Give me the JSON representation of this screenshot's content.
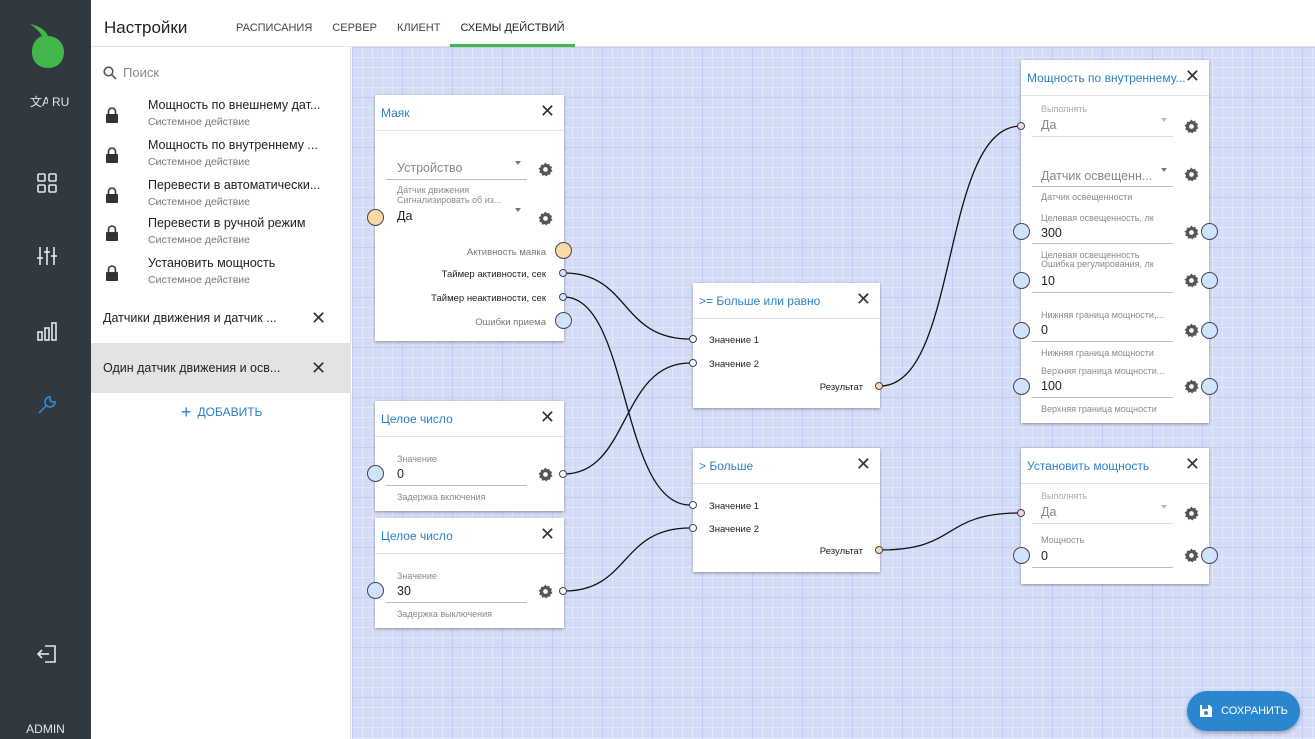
{
  "rail": {
    "language": "RU",
    "user": "ADMIN"
  },
  "header": {
    "title": "Настройки",
    "tabs": [
      {
        "label": "РАСПИСАНИЯ",
        "active": false
      },
      {
        "label": "СЕРВЕР",
        "active": false
      },
      {
        "label": "КЛИЕНТ",
        "active": false
      },
      {
        "label": "СХЕМЫ ДЕЙСТВИЙ",
        "active": true
      }
    ]
  },
  "panel": {
    "search_placeholder": "Поиск",
    "system_actions": [
      {
        "name": "Мощность по внешнему дат...",
        "sub": "Системное действие"
      },
      {
        "name": "Мощность по внутреннему ...",
        "sub": "Системное действие"
      },
      {
        "name": "Перевести в автоматически...",
        "sub": "Системное действие"
      },
      {
        "name": "Перевести в ручной режим",
        "sub": "Системное действие"
      },
      {
        "name": "Установить мощность",
        "sub": "Системное действие"
      }
    ],
    "schemes": [
      {
        "name": "Датчики движения и датчик ...",
        "selected": false
      },
      {
        "name": "Один датчик движения и осв...",
        "selected": true
      }
    ],
    "add_label": "ДОБАВИТЬ"
  },
  "nodes": {
    "beacon": {
      "title": "Маяк",
      "device_placeholder": "Устройство",
      "device_hint": "Датчик движения",
      "signal_label": "Сигнализировать об из...",
      "signal_value": "Да",
      "outputs": [
        "Активность маяка",
        "Таймер активности, сек",
        "Таймер неактивности, сек",
        "Ошибки приема"
      ]
    },
    "int1": {
      "title": "Целое число",
      "label": "Значение",
      "value": "0",
      "caption": "Задержка включения"
    },
    "int2": {
      "title": "Целое число",
      "label": "Значение",
      "value": "30",
      "caption": "Задержка выключения"
    },
    "gte": {
      "title": ">= Больше или равно",
      "in1": "Значение 1",
      "in2": "Значение 2",
      "out": "Результат"
    },
    "gt": {
      "title": "> Больше",
      "in1": "Значение 1",
      "in2": "Значение 2",
      "out": "Результат"
    },
    "power_internal": {
      "title": "Мощность по внутреннему...",
      "exec_label": "Выполнять",
      "exec_value": "Да",
      "sensor_value": "Датчик освещенн...",
      "sensor_caption": "Датчик освещенности",
      "target_label": "Целевая освещенность, лк",
      "target_value": "300",
      "target_caption": "Целевая освещенность",
      "error_label": "Ошибка регулирования, лк",
      "error_value": "10",
      "low_label": "Нижняя граница мощности,...",
      "low_value": "0",
      "low_caption": "Нижняя граница мощности",
      "high_label": "Верхняя граница мощности...",
      "high_value": "100",
      "high_caption": "Верхняя граница мощности"
    },
    "set_power": {
      "title": "Установить мощность",
      "exec_label": "Выполнять",
      "exec_value": "Да",
      "power_label": "Мощность",
      "power_value": "0"
    }
  },
  "save_label": "СОХРАНИТЬ",
  "colors": {
    "accent": "#2b80c7",
    "tab_active": "#43b649",
    "rail": "#2f393f",
    "canvas": "#d3dcf7",
    "save": "#2b86d0"
  }
}
